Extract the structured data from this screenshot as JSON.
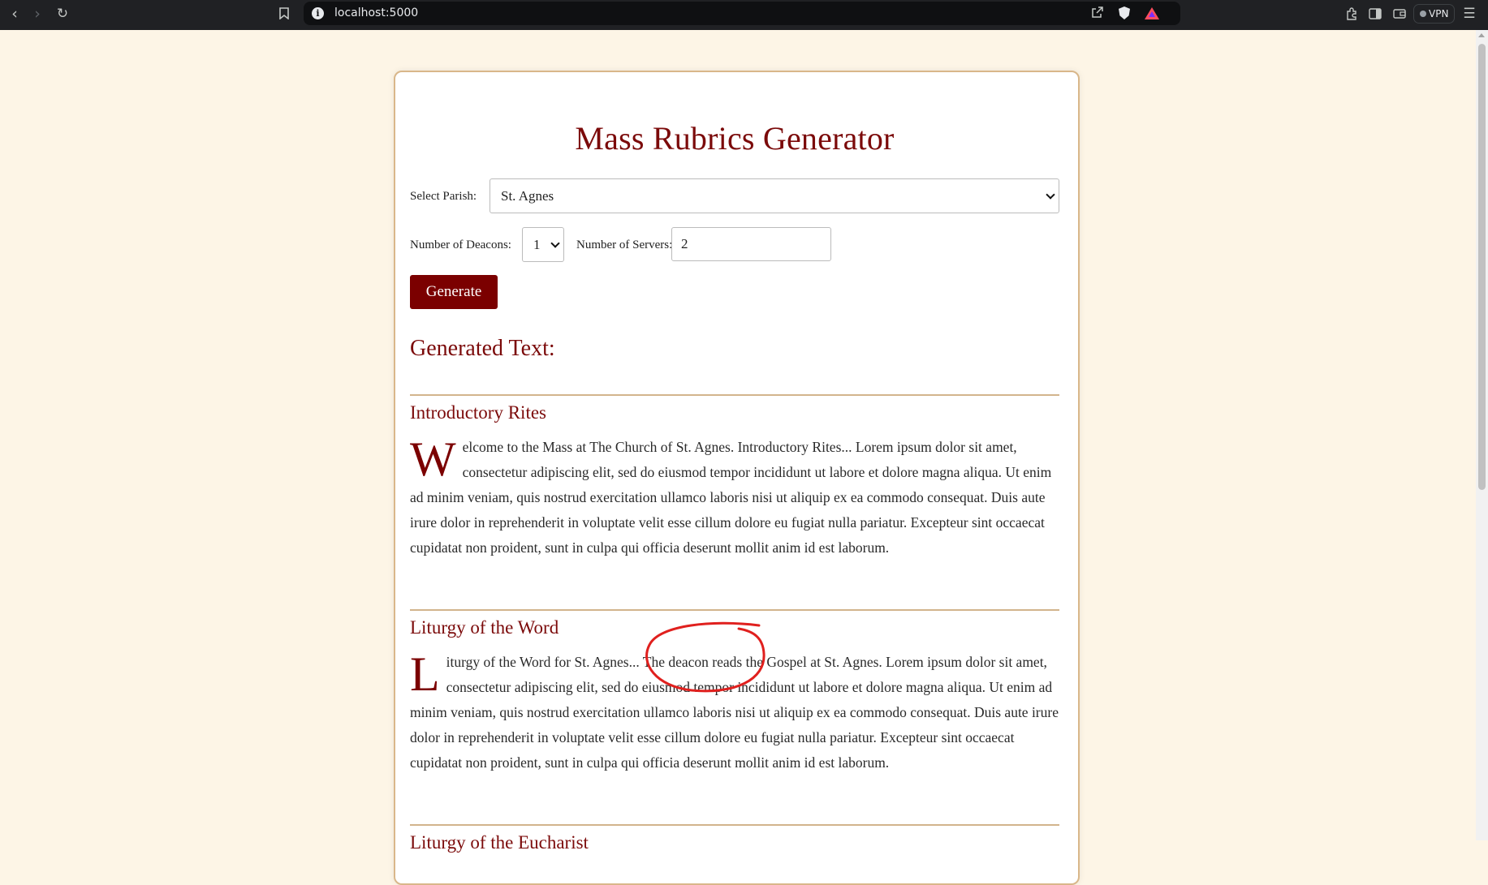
{
  "browser": {
    "url": "localhost:5000",
    "vpn_label": "VPN",
    "icons": [
      "back-icon",
      "forward-icon",
      "reload-icon",
      "bookmark-icon",
      "site-info-icon",
      "share-icon",
      "brave-shield-icon",
      "brave-rewards-icon",
      "extensions-icon",
      "sidebar-icon",
      "wallet-icon",
      "menu-icon"
    ]
  },
  "page": {
    "title": "Mass Rubrics Generator",
    "parish_label": "Select Parish:",
    "parish_value": "St. Agnes",
    "deacons_label": "Number of Deacons:",
    "deacons_value": "1",
    "servers_label": "Number of Servers:",
    "servers_value": "2",
    "generate_label": "Generate",
    "generated_heading": "Generated Text:"
  },
  "sections": [
    {
      "heading": "Introductory Rites",
      "dropcap": "W",
      "text": "elcome to the Mass at The Church of St. Agnes. Introductory Rites... Lorem ipsum dolor sit amet, consectetur adipiscing elit, sed do eiusmod tempor incididunt ut labore et dolore magna aliqua. Ut enim ad minim veniam, quis nostrud exercitation ullamco laboris nisi ut aliquip ex ea commodo consequat. Duis aute irure dolor in reprehenderit in voluptate velit esse cillum dolore eu fugiat nulla pariatur. Excepteur sint occaecat cupidatat non proident, sunt in culpa qui officia deserunt mollit anim id est laborum."
    },
    {
      "heading": "Liturgy of the Word",
      "dropcap": "L",
      "text": "iturgy of the Word for St. Agnes... The deacon reads the Gospel at St. Agnes. Lorem ipsum dolor sit amet, consectetur adipiscing elit, sed do eiusmod tempor incididunt ut labore et dolore magna aliqua. Ut enim ad minim veniam, quis nostrud exercitation ullamco laboris nisi ut aliquip ex ea commodo consequat. Duis aute irure dolor in reprehenderit in voluptate velit esse cillum dolore eu fugiat nulla pariatur. Excepteur sint occaecat cupidatat non proident, sunt in culpa qui officia deserunt mollit anim id est laborum."
    },
    {
      "heading": "Liturgy of the Eucharist"
    }
  ],
  "colors": {
    "accent": "#7b0a0a",
    "button": "#7b0000",
    "background": "#fdf5e6",
    "border": "#d9b78a",
    "annotation": "#e0201e"
  }
}
